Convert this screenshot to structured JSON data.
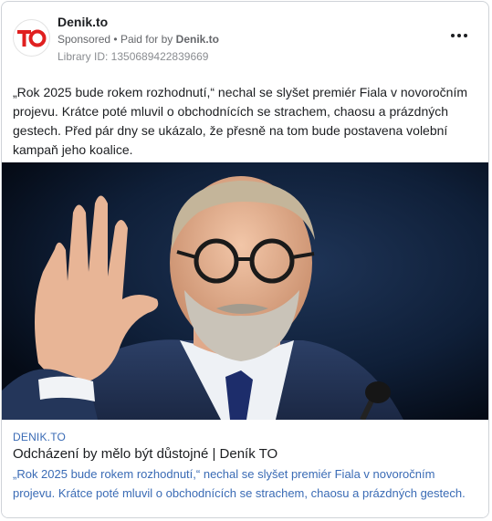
{
  "advertiser": {
    "name": "Denik.to",
    "logo_text": "TO",
    "sponsored_label": "Sponsored",
    "separator": "•",
    "paid_for_prefix": "Paid for by",
    "paid_for_name": "Denik.to",
    "library_id": "Library ID: 1350689422839669"
  },
  "menu": {
    "icon": "more-dots-icon"
  },
  "ad_text": "„Rok 2025 bude rokem rozhodnutí,“ nechal se slyšet premiér Fiala v novoročním projevu. Krátce poté mluvil o obchodnících se strachem, chaosu a prázdných gestech. Před pár dny se ukázalo, že přesně na tom bude postavena volební kampaň jeho koalice.",
  "link": {
    "domain": "DENIK.TO",
    "title": "Odcházení by mělo být důstojné | Deník TO",
    "description": "„Rok 2025 bude rokem rozhodnutí,“ nechal se slyšet premiér Fiala v novoročním projevu. Krátce poté mluvil o obchodnících se strachem, chaosu a prázdných gestech."
  },
  "colors": {
    "brand_red": "#e02020",
    "link_blue": "#3a6bb5",
    "background_dark": "#0d1a2e"
  }
}
